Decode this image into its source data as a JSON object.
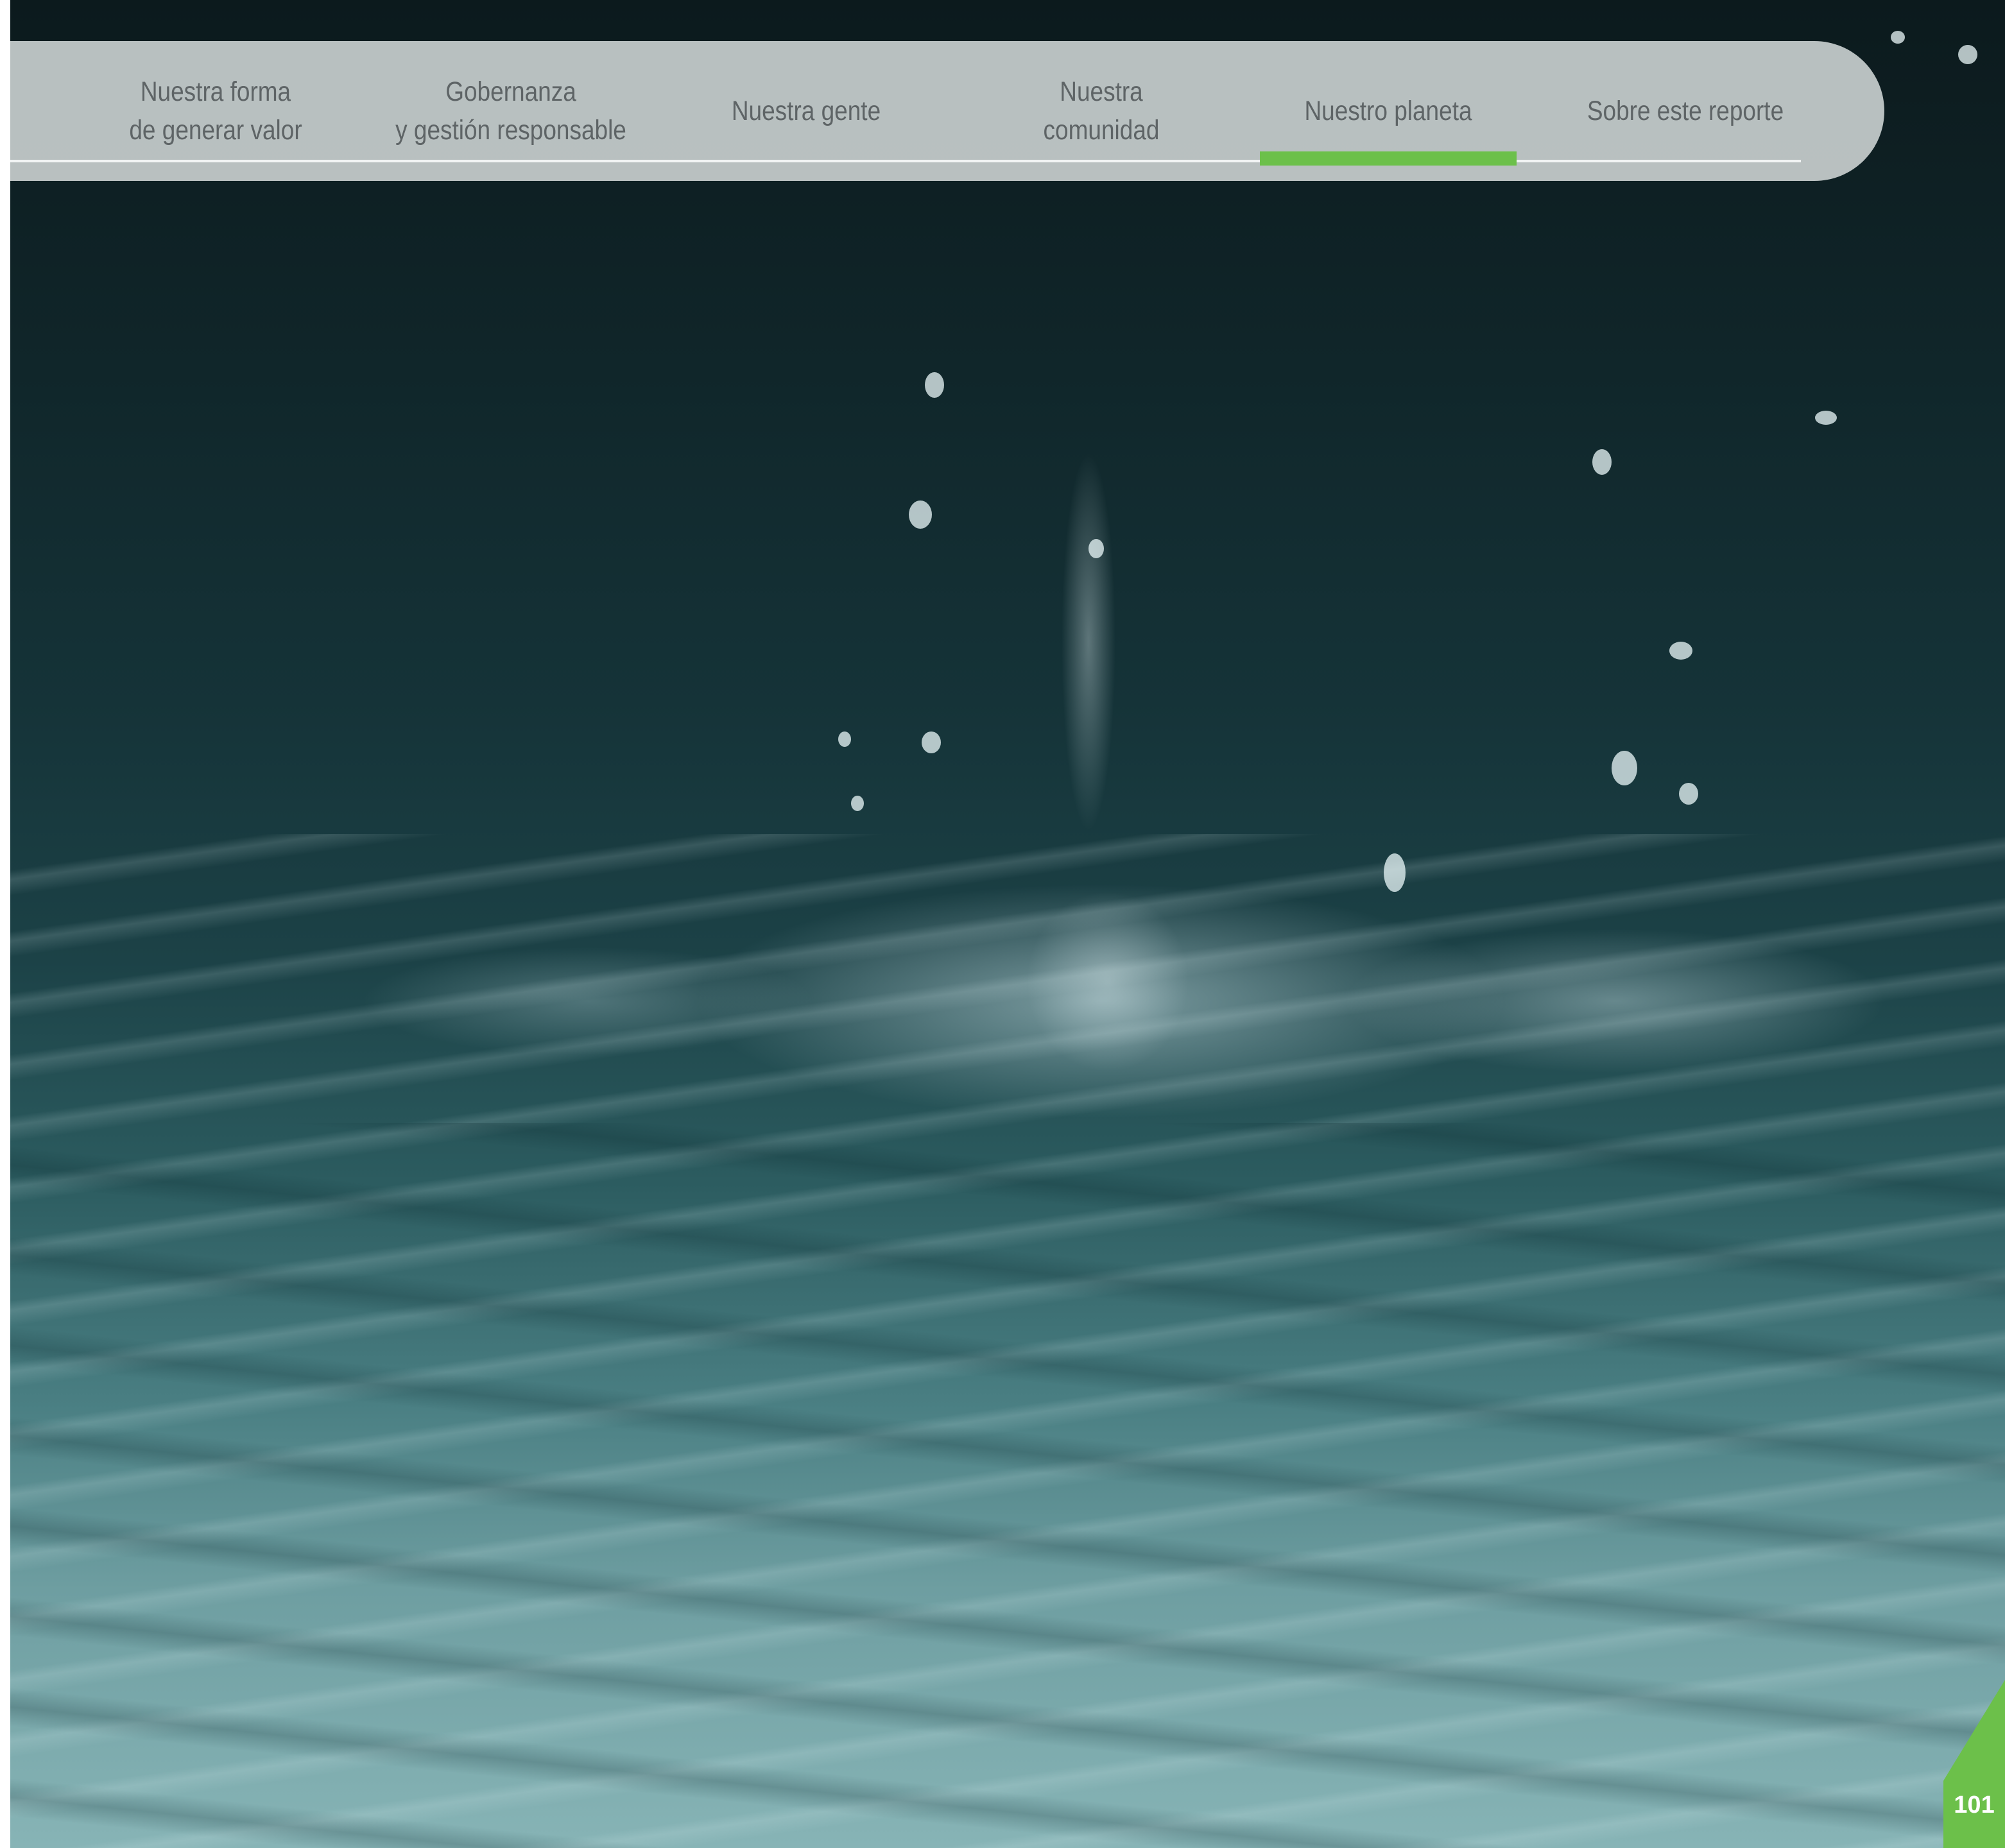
{
  "navigation": {
    "items": [
      {
        "label": "Nuestra forma\nde generar valor"
      },
      {
        "label": "Gobernanza\ny gestión responsable"
      },
      {
        "label": "Nuestra gente"
      },
      {
        "label": "Nuestra\ncomunidad"
      },
      {
        "label": "Nuestro planeta",
        "active": true
      },
      {
        "label": "Sobre este reporte"
      }
    ],
    "active_index": 4,
    "active_color": "#6cc04a"
  },
  "photo": {
    "subject_icon": "water-splash-photo"
  },
  "page": {
    "number": "101",
    "corner_color": "#6cc04a"
  }
}
